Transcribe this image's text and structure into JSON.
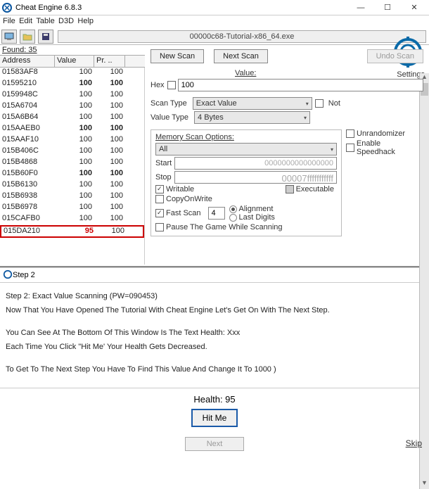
{
  "window": {
    "title": "Cheat Engine 6.8.3"
  },
  "menu": {
    "file": "File",
    "edit": "Edit",
    "table": "Table",
    "d3d": "D3D",
    "help": "Help"
  },
  "process": "00000c68-Tutorial-x86_64.exe",
  "settings_label": "Settings",
  "found_label": "Found: 35",
  "cols": {
    "addr": "Address",
    "val": "Value",
    "pr": "Pr. .."
  },
  "rows": [
    {
      "addr": "01583AF8",
      "val": "100",
      "pr": "100",
      "bold": false
    },
    {
      "addr": "01595210",
      "val": "100",
      "pr": "100",
      "bold": true
    },
    {
      "addr": "0159948C",
      "val": "100",
      "pr": "100",
      "bold": false
    },
    {
      "addr": "015A6704",
      "val": "100",
      "pr": "100",
      "bold": false
    },
    {
      "addr": "015A6B64",
      "val": "100",
      "pr": "100",
      "bold": false
    },
    {
      "addr": "015AAEB0",
      "val": "100",
      "pr": "100",
      "bold": true
    },
    {
      "addr": "015AAF10",
      "val": "100",
      "pr": "100",
      "bold": false
    },
    {
      "addr": "015B406C",
      "val": "100",
      "pr": "100",
      "bold": false
    },
    {
      "addr": "015B4868",
      "val": "100",
      "pr": "100",
      "bold": false
    },
    {
      "addr": "015B60F0",
      "val": "100",
      "pr": "100",
      "bold": true
    },
    {
      "addr": "015B6130",
      "val": "100",
      "pr": "100",
      "bold": false
    },
    {
      "addr": "015B6938",
      "val": "100",
      "pr": "100",
      "bold": false
    },
    {
      "addr": "015B6978",
      "val": "100",
      "pr": "100",
      "bold": false
    },
    {
      "addr": "015CAFB0",
      "val": "100",
      "pr": "100",
      "bold": false
    },
    {
      "addr": "015DA210",
      "val": "95",
      "pr": "100",
      "sel": true
    }
  ],
  "scan": {
    "new": "New Scan",
    "next": "Next Scan",
    "undo": "Undo Scan",
    "value_label": "Value:",
    "hex": "Hex",
    "value": "100",
    "scantype_label": "Scan Type",
    "scantype": "Exact Value",
    "valtype_label": "Value Type",
    "valtype": "4 Bytes",
    "not": "Not",
    "mem_label": "Memory Scan Options:",
    "mem_sel": "All",
    "start_label": "Start",
    "start": "0000000000000000",
    "stop_label": "Stop",
    "stop": "00007fffffffffff",
    "writable": "Writable",
    "executable": "Executable",
    "cow": "CopyOnWrite",
    "fastscan": "Fast Scan",
    "fastscan_val": "4",
    "alignment": "Alignment",
    "lastdigits": "Last Digits",
    "pause": "Pause The Game While Scanning",
    "unrandom": "Unrandomizer",
    "speedhack": "Enable Speedhack"
  },
  "step2": {
    "title": "Step 2",
    "t1": "Step 2: Exact Value Scanning (PW=090453)",
    "t2": "Now That You Have Opened The Tutorial With Cheat Engine Let's Get On With The Next Step.",
    "t3": "You Can See At The Bottom Of This Window Is The Text Health: Xxx",
    "t4": "Each Time You Click \"Hit Me' Your Health Gets Decreased.",
    "t5": "To Get To The Next Step You Have To Find This Value And Change It To 1000 )"
  },
  "bottom": {
    "health": "Health: 95",
    "hitme": "Hit Me",
    "next": "Next",
    "skip": "Skip"
  }
}
